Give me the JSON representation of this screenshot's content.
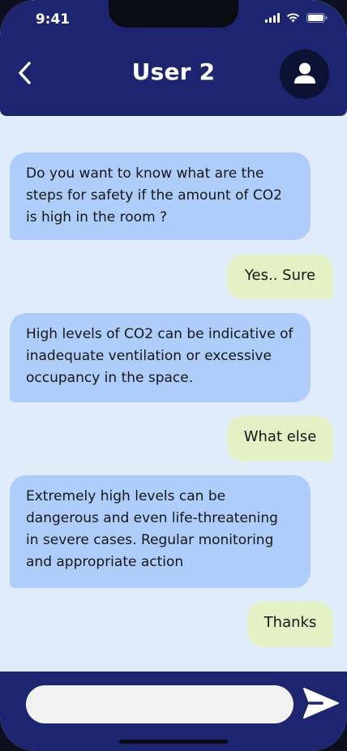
{
  "status_bar": {
    "time": "9:41"
  },
  "header": {
    "title": "User 2"
  },
  "messages": [
    {
      "direction": "incoming",
      "text": "Do you want to know what are the steps for safety if the amount of CO2 is high in the room ?"
    },
    {
      "direction": "outgoing",
      "text": "Yes.. Sure"
    },
    {
      "direction": "incoming",
      "text": "High levels of CO2 can be indicative of inadequate ventilation or excessive occupancy in the space."
    },
    {
      "direction": "outgoing",
      "text": "What else"
    },
    {
      "direction": "incoming",
      "text": "Extremely high levels can be dangerous and even life-threatening in severe cases. Regular monitoring and appropriate action"
    },
    {
      "direction": "outgoing",
      "text": "Thanks"
    }
  ],
  "composer": {
    "value": "",
    "placeholder": ""
  },
  "icons": {
    "back": "chevron-left-icon",
    "avatar": "user-icon",
    "send": "send-icon",
    "signal": "signal-icon",
    "wifi": "wifi-icon",
    "battery": "battery-icon"
  },
  "colors": {
    "header_bg": "#1e2570",
    "chat_bg": "#e1ecfb",
    "incoming_bubble": "#aecdfb",
    "outgoing_bubble": "#e4f1c4",
    "avatar_bg": "#0b1233"
  }
}
